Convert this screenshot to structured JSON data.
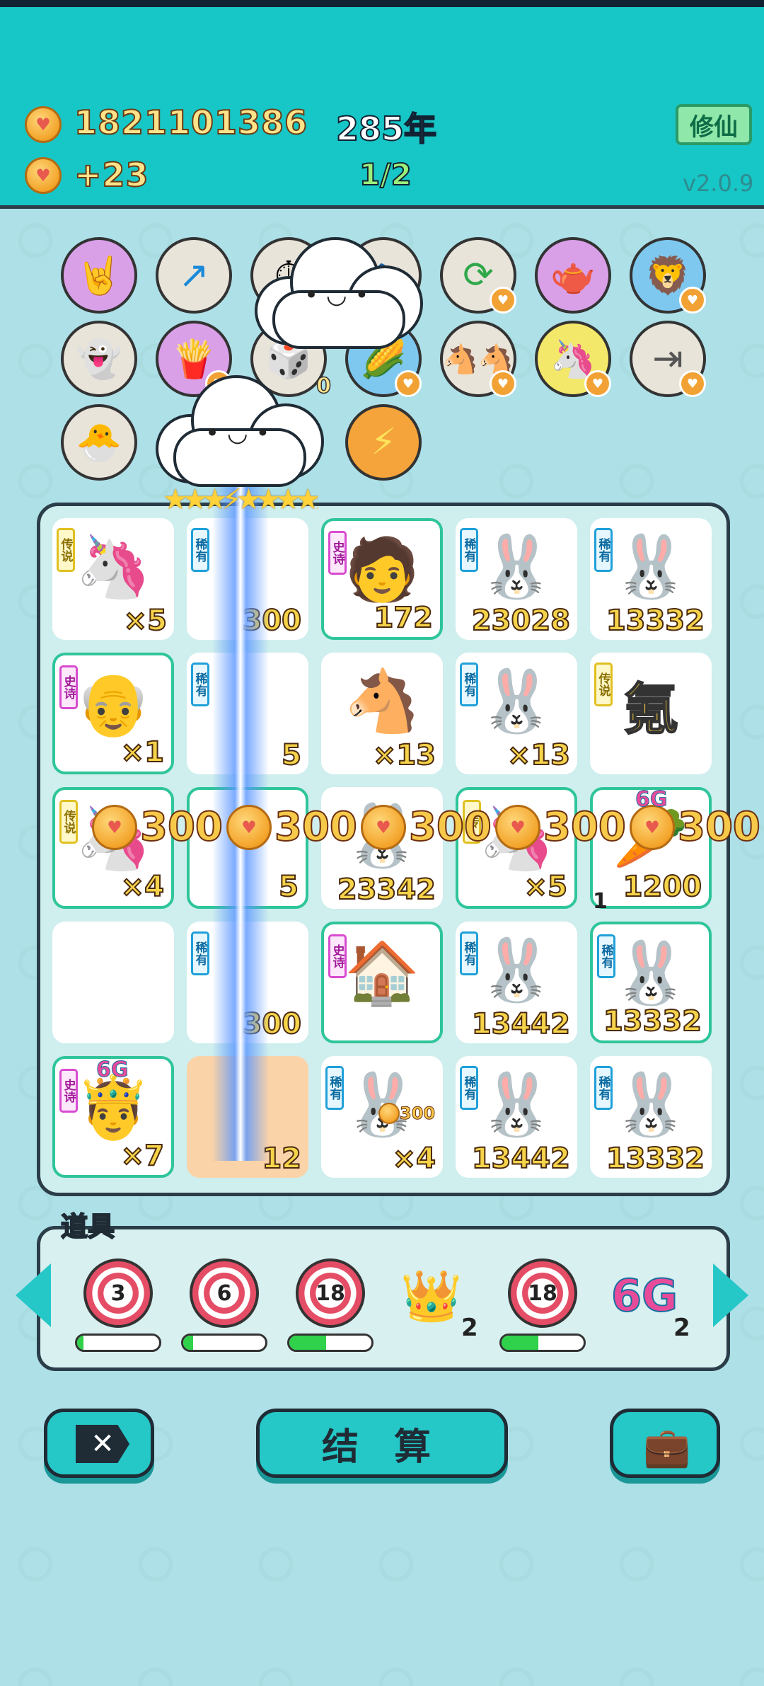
{
  "header": {
    "coins": "1821101386",
    "income": "+23",
    "year": "285年",
    "page": "1/2",
    "cultivate_label": "修仙",
    "version": "v2.0.9"
  },
  "badges": {
    "row1": [
      "rock-hand",
      "arrow-up-right",
      "stopwatch",
      "fish",
      "refresh",
      "gravy-boat",
      "lion"
    ],
    "row2": [
      "ghost",
      "fries",
      "dice-0",
      "corn",
      "horse-couple",
      "unicorn",
      "skip-end"
    ],
    "row3": [
      "chick",
      "cloud",
      "lightning"
    ],
    "dice_zero": "0"
  },
  "board": {
    "cells": [
      {
        "tag": "传说",
        "count": "×5",
        "emoji": "🦄"
      },
      {
        "tag": "稀有",
        "count": "300",
        "emoji": ""
      },
      {
        "tag": "史诗",
        "count": "172",
        "emoji": "🧑"
      },
      {
        "tag": "稀有",
        "count": "23028",
        "emoji": "🐰"
      },
      {
        "tag": "稀有",
        "count": "13332",
        "emoji": "🐰"
      },
      {
        "tag": "史诗",
        "count": "×1",
        "emoji": "👴"
      },
      {
        "tag": "稀有",
        "count": "5",
        "emoji": ""
      },
      {
        "tag": "",
        "count": "×13",
        "emoji": "🐴"
      },
      {
        "tag": "稀有",
        "count": "×13",
        "emoji": "🐰"
      },
      {
        "tag": "传说",
        "count": "",
        "emoji": "氪"
      },
      {
        "tag": "传说",
        "count": "×4",
        "emoji": "🦄"
      },
      {
        "tag": "",
        "count": "5",
        "emoji": ""
      },
      {
        "tag": "",
        "count": "23342",
        "emoji": "🐰"
      },
      {
        "tag": "传",
        "count": "×5",
        "emoji": "🦄"
      },
      {
        "tag": "",
        "count": "1200",
        "emoji": "🥕"
      },
      {
        "tag": "",
        "count": "",
        "emoji": ""
      },
      {
        "tag": "稀有",
        "count": "300",
        "emoji": ""
      },
      {
        "tag": "史诗",
        "count": "",
        "emoji": "🏠"
      },
      {
        "tag": "稀有",
        "count": "13442",
        "emoji": "🐰"
      },
      {
        "tag": "稀有",
        "count": "13332",
        "emoji": "🐰"
      },
      {
        "tag": "史诗",
        "count": "×7",
        "emoji": "🤴"
      },
      {
        "tag": "",
        "count": "12",
        "emoji": ""
      },
      {
        "tag": "稀有",
        "count": "×4",
        "emoji": "🐰"
      },
      {
        "tag": "稀有",
        "count": "13442",
        "emoji": "🐰"
      },
      {
        "tag": "稀有",
        "count": "13332",
        "emoji": "🐰"
      }
    ],
    "reward_value": "300",
    "small_reward": "300",
    "carrot_level": "1",
    "carrot_badge": "6G",
    "king_badge": "6G"
  },
  "tools": {
    "label": "道具",
    "items": [
      {
        "type": "target",
        "value": "3",
        "progress": 0.08
      },
      {
        "type": "target",
        "value": "6",
        "progress": 0.12
      },
      {
        "type": "target",
        "value": "18",
        "progress": 0.45
      },
      {
        "type": "crown",
        "count": "2"
      },
      {
        "type": "target",
        "value": "18",
        "progress": 0.45
      },
      {
        "type": "6g",
        "label": "6G",
        "count": "2"
      }
    ]
  },
  "actions": {
    "settle_label": "结 算",
    "close_icon": "close-icon",
    "bag_icon": "briefcase-icon"
  }
}
